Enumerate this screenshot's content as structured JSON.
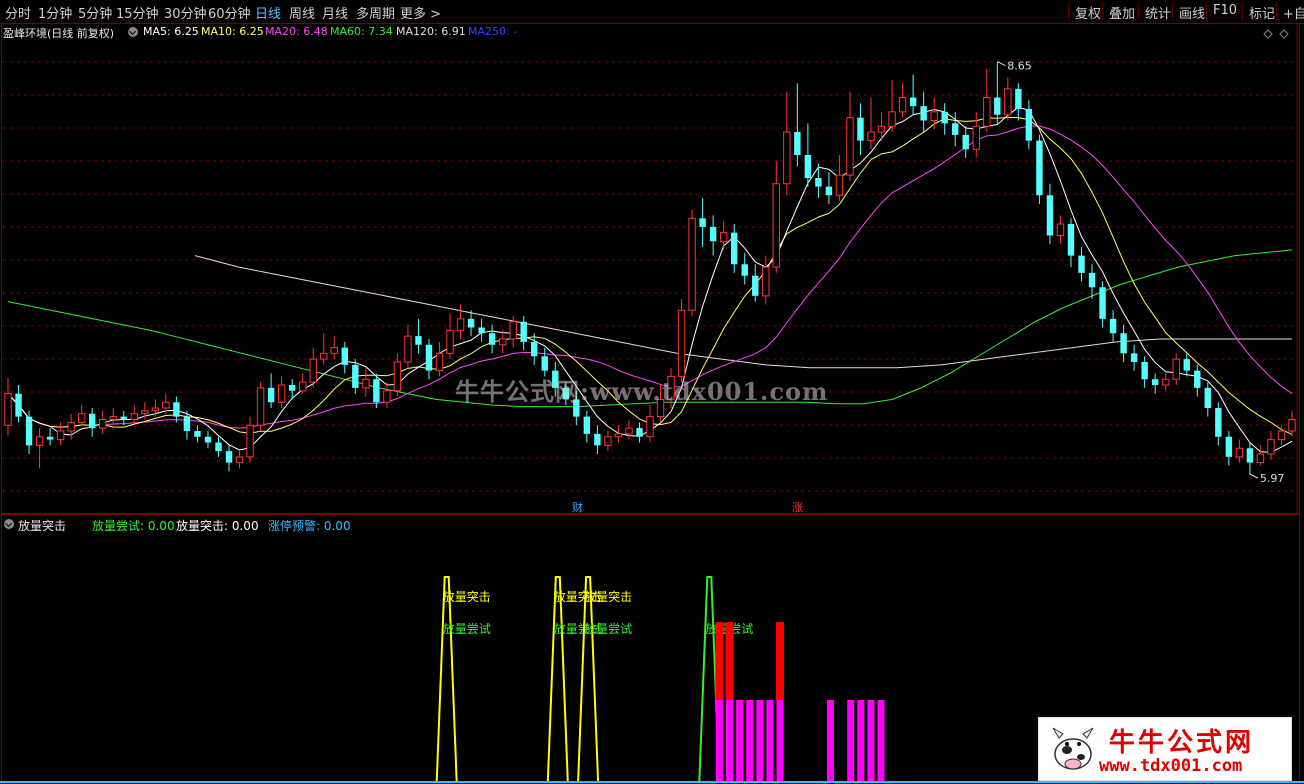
{
  "toolbar": {
    "periods": [
      "分时",
      "1分钟",
      "5分钟",
      "15分钟",
      "30分钟",
      "60分钟",
      "日线",
      "周线",
      "月线",
      "多周期",
      "更多 >"
    ],
    "active_period": "日线",
    "buttons": [
      "复权",
      "叠加",
      "统计",
      "画线",
      "F10",
      "标记",
      "+自选"
    ]
  },
  "main_legend": {
    "title": "盈峰环境(日线 前复权)",
    "ma": [
      {
        "label": "MA5: 6.25",
        "color": "#ffffff"
      },
      {
        "label": "MA10: 6.25",
        "color": "#ffff66"
      },
      {
        "label": "MA20: 6.48",
        "color": "#ff44ff"
      },
      {
        "label": "MA60: 7.34",
        "color": "#33ee33"
      },
      {
        "label": "MA120: 6.91",
        "color": "#dddddd"
      },
      {
        "label": "MA250: -",
        "color": "#3344ff"
      }
    ]
  },
  "price_annotations": {
    "high": "8.65",
    "low": "5.97"
  },
  "event_markers": {
    "cai": "财",
    "zhang": "涨"
  },
  "sub_legend": {
    "title": "放量突击",
    "items": [
      {
        "label": "放量尝试: 0.00",
        "color": "#33ee33"
      },
      {
        "label": "放量突击: 0.00",
        "color": "#ffffff"
      },
      {
        "label": "涨停预警: 0.00",
        "color": "#33bbff"
      }
    ]
  },
  "signal_labels": {
    "tuji": "放量突击",
    "changshi": "放量尝试"
  },
  "watermark": "牛牛公式网:www.tdx001.com",
  "logo": {
    "title": "牛牛公式网",
    "url": "www.tdx001.com"
  },
  "colors": {
    "up": "#ff3333",
    "down": "#54ffff",
    "ma5": "#ffffff",
    "ma10": "#ffff66",
    "ma20": "#ff44ff",
    "ma60": "#33ee33",
    "ma120": "#dddddd",
    "grid": "#7a0000",
    "tuji": "#ffff00",
    "changshi": "#33ee33",
    "bar_red": "#ff0000",
    "bar_mag": "#ff00ff"
  },
  "candles": [
    [
      6.12,
      6.34,
      6.45,
      6.05
    ],
    [
      6.34,
      6.18,
      6.4,
      6.14
    ],
    [
      6.18,
      5.98,
      6.22,
      5.92
    ],
    [
      5.98,
      6.04,
      6.1,
      5.82
    ],
    [
      6.04,
      6.02,
      6.1,
      5.98
    ],
    [
      6.02,
      6.08,
      6.14,
      5.98
    ],
    [
      6.08,
      6.14,
      6.2,
      6.02
    ],
    [
      6.14,
      6.2,
      6.26,
      6.12
    ],
    [
      6.2,
      6.1,
      6.24,
      6.04
    ],
    [
      6.1,
      6.16,
      6.22,
      6.06
    ],
    [
      6.16,
      6.18,
      6.24,
      6.12
    ],
    [
      6.18,
      6.16,
      6.22,
      6.12
    ],
    [
      6.16,
      6.2,
      6.26,
      6.14
    ],
    [
      6.2,
      6.22,
      6.28,
      6.16
    ],
    [
      6.22,
      6.24,
      6.3,
      6.18
    ],
    [
      6.24,
      6.28,
      6.34,
      6.2
    ],
    [
      6.28,
      6.18,
      6.32,
      6.14
    ],
    [
      6.18,
      6.08,
      6.22,
      6.02
    ],
    [
      6.08,
      6.04,
      6.12,
      6.0
    ],
    [
      6.04,
      6.0,
      6.08,
      5.96
    ],
    [
      6.0,
      5.94,
      6.04,
      5.9
    ],
    [
      5.94,
      5.86,
      5.98,
      5.8
    ],
    [
      5.86,
      5.9,
      5.94,
      5.82
    ],
    [
      5.9,
      6.12,
      6.18,
      5.86
    ],
    [
      6.12,
      6.38,
      6.42,
      6.08
    ],
    [
      6.38,
      6.28,
      6.48,
      6.24
    ],
    [
      6.28,
      6.4,
      6.46,
      6.24
    ],
    [
      6.4,
      6.36,
      6.44,
      6.3
    ],
    [
      6.36,
      6.42,
      6.48,
      6.34
    ],
    [
      6.42,
      6.58,
      6.66,
      6.38
    ],
    [
      6.58,
      6.62,
      6.76,
      6.54
    ],
    [
      6.62,
      6.66,
      6.74,
      6.58
    ],
    [
      6.66,
      6.54,
      6.7,
      6.48
    ],
    [
      6.54,
      6.38,
      6.58,
      6.34
    ],
    [
      6.38,
      6.44,
      6.52,
      6.32
    ],
    [
      6.44,
      6.28,
      6.48,
      6.24
    ],
    [
      6.28,
      6.36,
      6.42,
      6.24
    ],
    [
      6.36,
      6.56,
      6.62,
      6.32
    ],
    [
      6.56,
      6.74,
      6.82,
      6.52
    ],
    [
      6.74,
      6.68,
      6.86,
      6.62
    ],
    [
      6.68,
      6.5,
      6.72,
      6.44
    ],
    [
      6.5,
      6.62,
      6.7,
      6.46
    ],
    [
      6.62,
      6.78,
      6.9,
      6.58
    ],
    [
      6.78,
      6.86,
      6.96,
      6.72
    ],
    [
      6.86,
      6.8,
      6.92,
      6.74
    ],
    [
      6.8,
      6.76,
      6.86,
      6.7
    ],
    [
      6.76,
      6.68,
      6.82,
      6.62
    ],
    [
      6.68,
      6.72,
      6.78,
      6.62
    ],
    [
      6.72,
      6.84,
      6.88,
      6.66
    ],
    [
      6.84,
      6.7,
      6.88,
      6.64
    ],
    [
      6.7,
      6.6,
      6.76,
      6.54
    ],
    [
      6.6,
      6.5,
      6.66,
      6.46
    ],
    [
      6.5,
      6.38,
      6.56,
      6.32
    ],
    [
      6.38,
      6.3,
      6.42,
      6.26
    ],
    [
      6.3,
      6.18,
      6.36,
      6.12
    ],
    [
      6.18,
      6.06,
      6.22,
      6.0
    ],
    [
      6.06,
      5.98,
      6.12,
      5.92
    ],
    [
      5.98,
      6.04,
      6.08,
      5.94
    ],
    [
      6.04,
      6.06,
      6.12,
      6.0
    ],
    [
      6.06,
      6.1,
      6.16,
      6.02
    ],
    [
      6.1,
      6.04,
      6.14,
      6.0
    ],
    [
      6.04,
      6.18,
      6.26,
      6.0
    ],
    [
      6.18,
      6.3,
      6.4,
      6.14
    ],
    [
      6.3,
      6.46,
      6.52,
      6.24
    ],
    [
      6.46,
      6.92,
      7.0,
      6.42
    ],
    [
      6.92,
      7.56,
      7.62,
      6.88
    ],
    [
      7.56,
      7.5,
      7.7,
      7.36
    ],
    [
      7.5,
      7.4,
      7.58,
      7.3
    ],
    [
      7.4,
      7.46,
      7.54,
      7.34
    ],
    [
      7.46,
      7.24,
      7.52,
      7.18
    ],
    [
      7.24,
      7.16,
      7.32,
      7.1
    ],
    [
      7.16,
      7.02,
      7.24,
      6.98
    ],
    [
      7.02,
      7.22,
      7.3,
      6.96
    ],
    [
      7.22,
      7.8,
      7.96,
      7.18
    ],
    [
      7.8,
      8.16,
      8.44,
      7.72
    ],
    [
      8.16,
      8.0,
      8.5,
      7.92
    ],
    [
      8.0,
      7.84,
      8.22,
      7.78
    ],
    [
      7.84,
      7.78,
      7.94,
      7.7
    ],
    [
      7.78,
      7.72,
      7.88,
      7.66
    ],
    [
      7.72,
      7.86,
      8.0,
      7.68
    ],
    [
      7.86,
      8.26,
      8.44,
      7.82
    ],
    [
      8.26,
      8.1,
      8.36,
      8.0
    ],
    [
      8.1,
      8.16,
      8.4,
      8.04
    ],
    [
      8.16,
      8.2,
      8.3,
      8.1
    ],
    [
      8.2,
      8.3,
      8.52,
      8.16
    ],
    [
      8.3,
      8.4,
      8.5,
      8.26
    ],
    [
      8.4,
      8.34,
      8.56,
      8.28
    ],
    [
      8.34,
      8.24,
      8.44,
      8.16
    ],
    [
      8.24,
      8.3,
      8.4,
      8.18
    ],
    [
      8.3,
      8.22,
      8.36,
      8.14
    ],
    [
      8.22,
      8.14,
      8.3,
      8.06
    ],
    [
      8.14,
      8.04,
      8.2,
      7.98
    ],
    [
      8.04,
      8.2,
      8.3,
      7.98
    ],
    [
      8.2,
      8.4,
      8.6,
      8.16
    ],
    [
      8.4,
      8.28,
      8.65,
      8.22
    ],
    [
      8.28,
      8.46,
      8.54,
      8.24
    ],
    [
      8.46,
      8.32,
      8.5,
      8.24
    ],
    [
      8.32,
      8.1,
      8.38,
      8.04
    ],
    [
      8.1,
      7.72,
      8.14,
      7.66
    ],
    [
      7.72,
      7.44,
      7.8,
      7.38
    ],
    [
      7.44,
      7.52,
      7.58,
      7.38
    ],
    [
      7.52,
      7.3,
      7.56,
      7.22
    ],
    [
      7.3,
      7.18,
      7.36,
      7.12
    ],
    [
      7.18,
      7.08,
      7.24,
      7.0
    ],
    [
      7.08,
      6.86,
      7.12,
      6.8
    ],
    [
      6.86,
      6.76,
      6.92,
      6.7
    ],
    [
      6.76,
      6.62,
      6.82,
      6.56
    ],
    [
      6.62,
      6.56,
      6.68,
      6.5
    ],
    [
      6.56,
      6.44,
      6.6,
      6.38
    ],
    [
      6.44,
      6.4,
      6.48,
      6.34
    ],
    [
      6.4,
      6.44,
      6.48,
      6.36
    ],
    [
      6.44,
      6.58,
      6.62,
      6.4
    ],
    [
      6.58,
      6.5,
      6.62,
      6.46
    ],
    [
      6.5,
      6.38,
      6.54,
      6.32
    ],
    [
      6.38,
      6.24,
      6.42,
      6.18
    ],
    [
      6.24,
      6.04,
      6.28,
      5.98
    ],
    [
      6.04,
      5.9,
      6.08,
      5.84
    ],
    [
      5.9,
      5.96,
      6.02,
      5.86
    ],
    [
      5.96,
      5.86,
      6.0,
      5.78
    ],
    [
      5.86,
      5.92,
      5.98,
      5.84
    ],
    [
      5.92,
      6.02,
      6.08,
      5.88
    ],
    [
      6.02,
      6.08,
      6.12,
      5.98
    ],
    [
      6.08,
      6.16,
      6.22,
      6.04
    ]
  ],
  "ma60": [
    6.98,
    6.94,
    6.9,
    6.86,
    6.82,
    6.78,
    6.73,
    6.68,
    6.63,
    6.58,
    6.53,
    6.48,
    6.43,
    6.38,
    6.34,
    6.3,
    6.28,
    6.26,
    6.25,
    6.25,
    6.25,
    6.26,
    6.27,
    6.28,
    6.28,
    6.28,
    6.28,
    6.28,
    6.28,
    6.27,
    6.27,
    6.3,
    6.38,
    6.48,
    6.6,
    6.72,
    6.84,
    6.94,
    7.02,
    7.1,
    7.16,
    7.22,
    7.26,
    7.3,
    7.32,
    7.34
  ],
  "ma120": [
    7.3,
    7.22,
    7.16,
    7.1,
    7.04,
    6.98,
    6.92,
    6.86,
    6.8,
    6.74,
    6.68,
    6.62,
    6.58,
    6.54,
    6.52,
    6.52,
    6.52,
    6.54,
    6.58,
    6.62,
    6.66,
    6.7,
    6.72,
    6.72,
    6.72,
    6.72
  ],
  "signals": {
    "tuji_peaks": [
      17,
      28,
      31
    ],
    "changshi_peaks": [
      43
    ],
    "red_bars": [
      {
        "i": 44,
        "level": 0.78
      },
      {
        "i": 45,
        "level": 0.78
      },
      {
        "i": 50,
        "level": 0.78
      }
    ],
    "mag_bars": [
      44,
      45,
      46,
      47,
      48,
      49,
      50,
      55,
      57,
      58,
      59,
      60
    ]
  }
}
